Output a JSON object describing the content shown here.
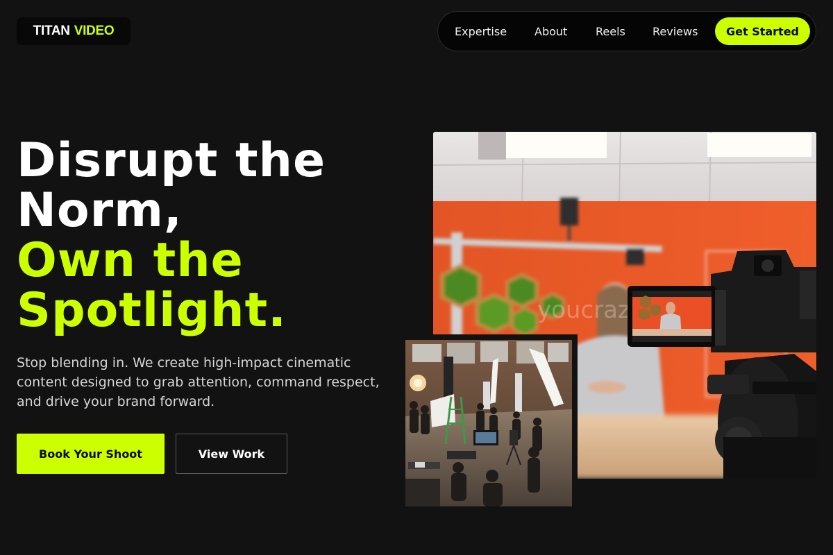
{
  "brand": {
    "part1": "TITAN",
    "part2": "VIDEO"
  },
  "nav": {
    "links": [
      "Expertise",
      "About",
      "Reels",
      "Reviews"
    ],
    "cta": "Get Started"
  },
  "hero": {
    "line1": "Disrupt the",
    "line2": "Norm,",
    "line3": "Own the",
    "line4": "Spotlight.",
    "subtitle": "Stop blending in. We create high-impact cinematic content designed to grab attention, command respect, and drive your brand forward.",
    "primary_button": "Book Your Shoot",
    "secondary_button": "View Work"
  },
  "images": {
    "main_watermark": "youcrazy.isa",
    "main_alt": "Studio camera filming presenter in front of orange wall",
    "secondary_alt": "Film crew on set in warehouse studio"
  },
  "colors": {
    "accent": "#ccff00",
    "background": "#121212"
  }
}
